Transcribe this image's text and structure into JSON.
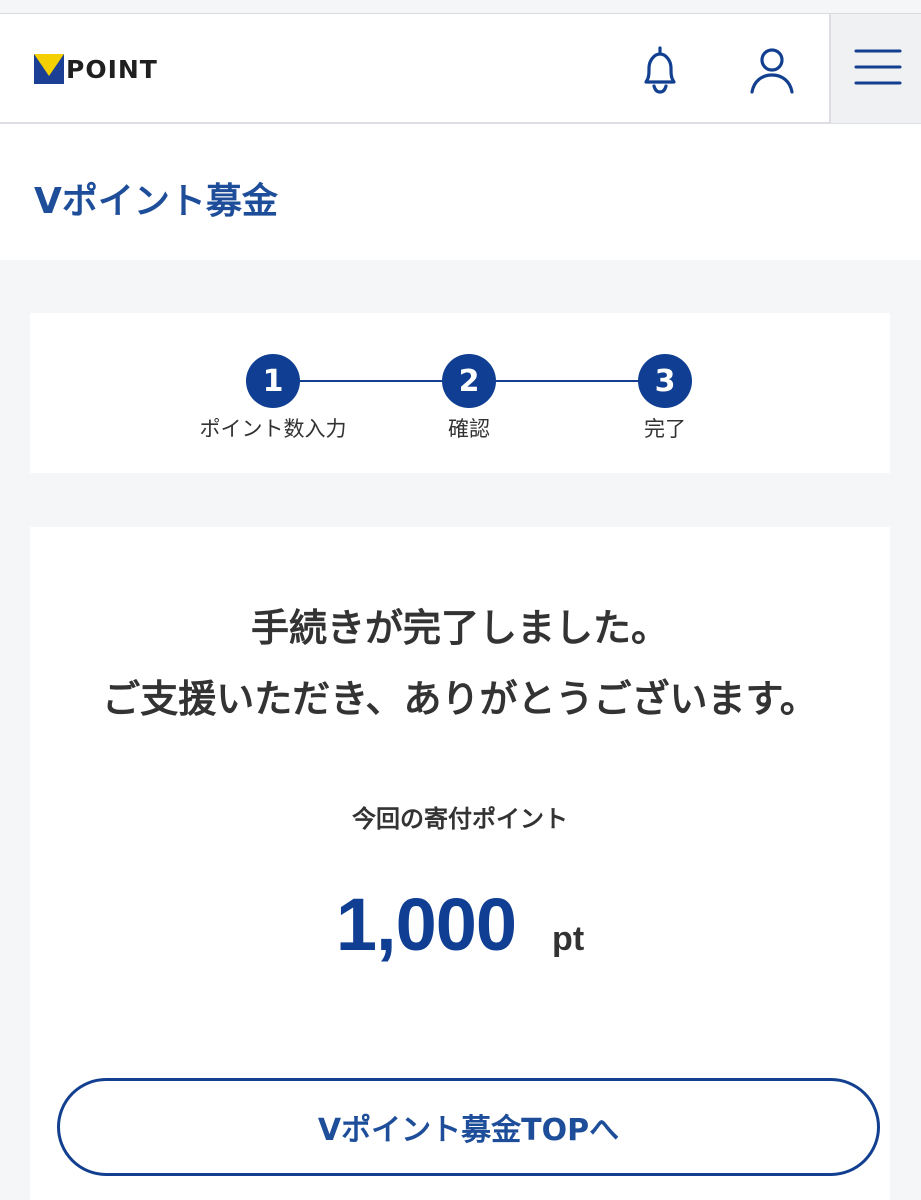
{
  "header": {
    "logo_text": "POINT",
    "icons": [
      "bell-icon",
      "user-icon",
      "hamburger-menu-icon"
    ]
  },
  "page": {
    "title": "Vポイント募金"
  },
  "stepper": {
    "steps": [
      {
        "number": "1",
        "label": "ポイント数入力"
      },
      {
        "number": "2",
        "label": "確認"
      },
      {
        "number": "3",
        "label": "完了"
      }
    ],
    "current_step": 3
  },
  "result": {
    "message_line1": "手続きが完了しました。",
    "message_line2": "ご支援いただき、ありがとうございます。",
    "donated_label": "今回の寄付ポイント",
    "amount": "1,000",
    "unit": "pt"
  },
  "actions": {
    "top_button_label": "Vポイント募金TOPへ"
  },
  "colors": {
    "brand_blue": "#0f3e92",
    "title_blue": "#1e4e9a",
    "logo_yellow": "#f5d000",
    "background": "#f5f6f8"
  }
}
